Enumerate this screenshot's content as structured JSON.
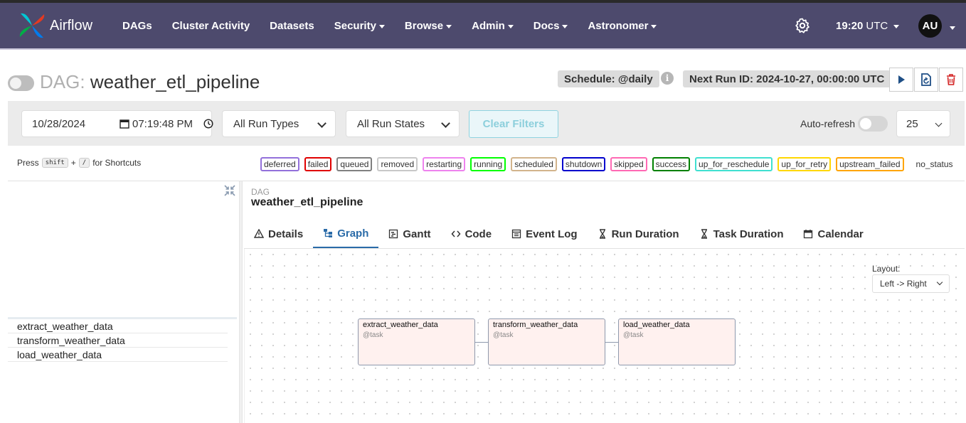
{
  "app": {
    "name": "Airflow"
  },
  "nav": {
    "items": [
      {
        "label": "DAGs",
        "dropdown": false
      },
      {
        "label": "Cluster Activity",
        "dropdown": false
      },
      {
        "label": "Datasets",
        "dropdown": false
      },
      {
        "label": "Security",
        "dropdown": true
      },
      {
        "label": "Browse",
        "dropdown": true
      },
      {
        "label": "Admin",
        "dropdown": true
      },
      {
        "label": "Docs",
        "dropdown": true
      },
      {
        "label": "Astronomer",
        "dropdown": true
      }
    ],
    "time": "19:20",
    "timezone": "UTC",
    "avatar": "AU",
    "gear_icon": "gear-icon"
  },
  "dag": {
    "prefix": "DAG:",
    "name": "weather_etl_pipeline",
    "schedule": "Schedule: @daily",
    "next_run": "Next Run ID: 2024-10-27, 00:00:00 UTC",
    "info_glyph": "i"
  },
  "filters": {
    "date": "10/28/2024",
    "time": "07:19:48 PM",
    "run_types": "All Run Types",
    "run_states": "All Run States",
    "clear_label": "Clear Filters",
    "auto_refresh_label": "Auto-refresh",
    "page_size": "25"
  },
  "shortcuts": {
    "press": "Press",
    "key1": "shift",
    "plus": "+",
    "key2": "/",
    "suffix": "for Shortcuts"
  },
  "legend": [
    {
      "label": "deferred",
      "color": "#9370db"
    },
    {
      "label": "failed",
      "color": "#e00000"
    },
    {
      "label": "queued",
      "color": "#808080"
    },
    {
      "label": "removed",
      "color": "#c8c8c8"
    },
    {
      "label": "restarting",
      "color": "#ee82ee"
    },
    {
      "label": "running",
      "color": "#00ff00"
    },
    {
      "label": "scheduled",
      "color": "#d2b48c"
    },
    {
      "label": "shutdown",
      "color": "#0000cd"
    },
    {
      "label": "skipped",
      "color": "#ff69b4"
    },
    {
      "label": "success",
      "color": "#008000"
    },
    {
      "label": "up_for_reschedule",
      "color": "#40e0d0"
    },
    {
      "label": "up_for_retry",
      "color": "#ffd700"
    },
    {
      "label": "upstream_failed",
      "color": "#ffa500"
    },
    {
      "label": "no_status",
      "color": ""
    }
  ],
  "tasks": [
    "extract_weather_data",
    "transform_weather_data",
    "load_weather_data"
  ],
  "detail": {
    "kicker": "DAG",
    "title": "weather_etl_pipeline",
    "tabs": [
      "Details",
      "Graph",
      "Gantt",
      "Code",
      "Event Log",
      "Run Duration",
      "Task Duration",
      "Calendar"
    ],
    "active_tab": "Graph"
  },
  "graph": {
    "layout_label": "Layout:",
    "layout_value": "Left -> Right",
    "nodes": [
      {
        "name": "extract_weather_data",
        "sub": "@task"
      },
      {
        "name": "transform_weather_data",
        "sub": "@task"
      },
      {
        "name": "load_weather_data",
        "sub": "@task"
      }
    ]
  }
}
